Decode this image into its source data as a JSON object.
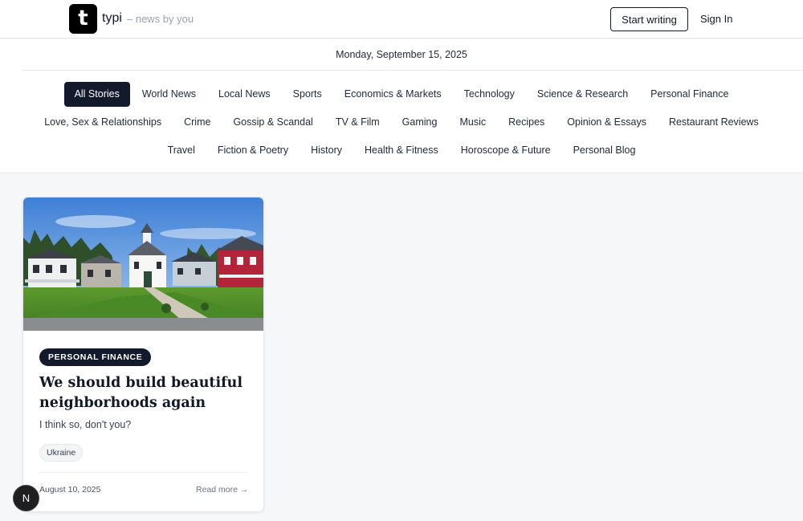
{
  "header": {
    "logo_letter": "t",
    "brand": "typi",
    "tagline": "– news by you",
    "start_writing_label": "Start writing",
    "sign_in_label": "Sign In"
  },
  "date_label": "Monday, September 15, 2025",
  "categories": {
    "row1": [
      "All Stories",
      "World News",
      "Local News",
      "Sports",
      "Economics & Markets",
      "Technology",
      "Science & Research",
      "Personal Finance"
    ],
    "row2": [
      "Love, Sex & Relationships",
      "Crime",
      "Gossip & Scandal",
      "TV & Film",
      "Gaming",
      "Music",
      "Recipes",
      "Opinion & Essays",
      "Restaurant Reviews"
    ],
    "row3": [
      "Travel",
      "Fiction & Poetry",
      "History",
      "Health & Fitness",
      "Horoscope & Future",
      "Personal Blog"
    ],
    "active": "All Stories"
  },
  "card": {
    "category": "PERSONAL FINANCE",
    "title": "We should build beautiful neighborhoods again",
    "excerpt": "I think so, don't you?",
    "tag": "Ukraine",
    "date": "August 10, 2025",
    "read_more": "Read more →"
  },
  "floating_button_label": "N",
  "colors": {
    "accent_dark": "#121a2c",
    "page_bg": "#f6f7f9"
  }
}
